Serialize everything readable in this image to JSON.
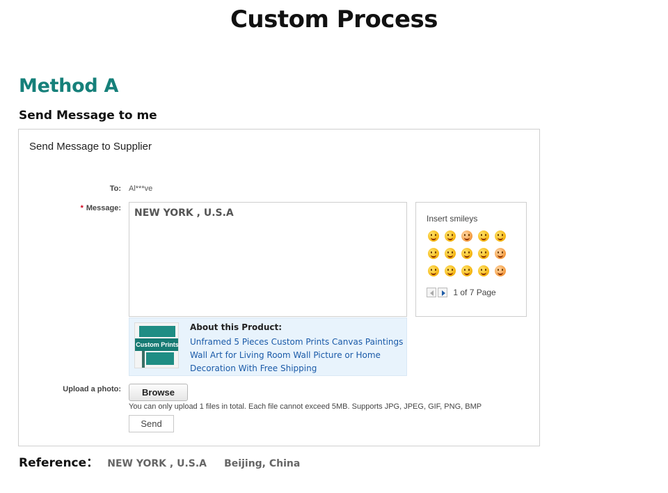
{
  "page_title": "Custom Process",
  "method_title": "Method A",
  "send_heading": "Send Message to me",
  "form": {
    "panel_title": "Send Message to Supplier",
    "to_label": "To:",
    "to_value": "Al***ve",
    "required_star": "*",
    "message_label": "Message:",
    "message_value": "NEW YORK , U.S.A",
    "product": {
      "heading": "About this Product:",
      "link_text": "Unframed 5 Pieces Custom Prints Canvas Paintings Wall Art for Living Room Wall Picture or Home Decoration With Free Shipping",
      "thumbnail_text": "Custom Prints"
    },
    "smileys": {
      "title": "Insert smileys",
      "icons": [
        "smile",
        "wink-tongue",
        "tongue",
        "grin",
        "laugh",
        "big-laugh",
        "blush",
        "surprise",
        "squint",
        "kiss",
        "hug",
        "grin-big",
        "sleepy",
        "love",
        "kiss-heart"
      ],
      "pager_text": "1 of 7 Page"
    },
    "upload_label": "Upload a photo:",
    "browse_label": "Browse",
    "upload_note": "You can only upload 1 files in total. Each file cannot exceed 5MB. Supports JPG, JPEG, GIF, PNG, BMP",
    "send_label": "Send"
  },
  "reference": {
    "label": "Reference：",
    "values": [
      "NEW YORK , U.S.A",
      "Beijing, China"
    ]
  },
  "colors": {
    "accent_teal": "#16807a",
    "link_blue": "#1a5aa8",
    "required_red": "#d0021b",
    "product_box_bg": "#e8f3fc"
  }
}
